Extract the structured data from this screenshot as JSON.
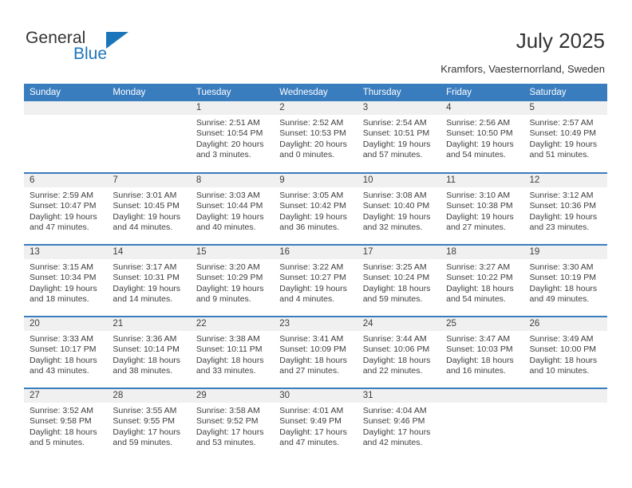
{
  "brand": {
    "name_part1": "General",
    "name_part2": "Blue",
    "triangle_color": "#1b75bb"
  },
  "header": {
    "title": "July 2025",
    "subtitle": "Kramfors, Vaesternorrland, Sweden"
  },
  "theme": {
    "header_blue": "#3a7dbf",
    "datenum_gray": "#f0f0f0",
    "text": "#3d3d3d"
  },
  "calendar": {
    "weekday_headers": [
      "Sunday",
      "Monday",
      "Tuesday",
      "Wednesday",
      "Thursday",
      "Friday",
      "Saturday"
    ],
    "weeks": [
      [
        {
          "empty": true
        },
        {
          "empty": true
        },
        {
          "day": "1",
          "sunrise": "Sunrise: 2:51 AM",
          "sunset": "Sunset: 10:54 PM",
          "daylight1": "Daylight: 20 hours",
          "daylight2": "and 3 minutes."
        },
        {
          "day": "2",
          "sunrise": "Sunrise: 2:52 AM",
          "sunset": "Sunset: 10:53 PM",
          "daylight1": "Daylight: 20 hours",
          "daylight2": "and 0 minutes."
        },
        {
          "day": "3",
          "sunrise": "Sunrise: 2:54 AM",
          "sunset": "Sunset: 10:51 PM",
          "daylight1": "Daylight: 19 hours",
          "daylight2": "and 57 minutes."
        },
        {
          "day": "4",
          "sunrise": "Sunrise: 2:56 AM",
          "sunset": "Sunset: 10:50 PM",
          "daylight1": "Daylight: 19 hours",
          "daylight2": "and 54 minutes."
        },
        {
          "day": "5",
          "sunrise": "Sunrise: 2:57 AM",
          "sunset": "Sunset: 10:49 PM",
          "daylight1": "Daylight: 19 hours",
          "daylight2": "and 51 minutes."
        }
      ],
      [
        {
          "day": "6",
          "sunrise": "Sunrise: 2:59 AM",
          "sunset": "Sunset: 10:47 PM",
          "daylight1": "Daylight: 19 hours",
          "daylight2": "and 47 minutes."
        },
        {
          "day": "7",
          "sunrise": "Sunrise: 3:01 AM",
          "sunset": "Sunset: 10:45 PM",
          "daylight1": "Daylight: 19 hours",
          "daylight2": "and 44 minutes."
        },
        {
          "day": "8",
          "sunrise": "Sunrise: 3:03 AM",
          "sunset": "Sunset: 10:44 PM",
          "daylight1": "Daylight: 19 hours",
          "daylight2": "and 40 minutes."
        },
        {
          "day": "9",
          "sunrise": "Sunrise: 3:05 AM",
          "sunset": "Sunset: 10:42 PM",
          "daylight1": "Daylight: 19 hours",
          "daylight2": "and 36 minutes."
        },
        {
          "day": "10",
          "sunrise": "Sunrise: 3:08 AM",
          "sunset": "Sunset: 10:40 PM",
          "daylight1": "Daylight: 19 hours",
          "daylight2": "and 32 minutes."
        },
        {
          "day": "11",
          "sunrise": "Sunrise: 3:10 AM",
          "sunset": "Sunset: 10:38 PM",
          "daylight1": "Daylight: 19 hours",
          "daylight2": "and 27 minutes."
        },
        {
          "day": "12",
          "sunrise": "Sunrise: 3:12 AM",
          "sunset": "Sunset: 10:36 PM",
          "daylight1": "Daylight: 19 hours",
          "daylight2": "and 23 minutes."
        }
      ],
      [
        {
          "day": "13",
          "sunrise": "Sunrise: 3:15 AM",
          "sunset": "Sunset: 10:34 PM",
          "daylight1": "Daylight: 19 hours",
          "daylight2": "and 18 minutes."
        },
        {
          "day": "14",
          "sunrise": "Sunrise: 3:17 AM",
          "sunset": "Sunset: 10:31 PM",
          "daylight1": "Daylight: 19 hours",
          "daylight2": "and 14 minutes."
        },
        {
          "day": "15",
          "sunrise": "Sunrise: 3:20 AM",
          "sunset": "Sunset: 10:29 PM",
          "daylight1": "Daylight: 19 hours",
          "daylight2": "and 9 minutes."
        },
        {
          "day": "16",
          "sunrise": "Sunrise: 3:22 AM",
          "sunset": "Sunset: 10:27 PM",
          "daylight1": "Daylight: 19 hours",
          "daylight2": "and 4 minutes."
        },
        {
          "day": "17",
          "sunrise": "Sunrise: 3:25 AM",
          "sunset": "Sunset: 10:24 PM",
          "daylight1": "Daylight: 18 hours",
          "daylight2": "and 59 minutes."
        },
        {
          "day": "18",
          "sunrise": "Sunrise: 3:27 AM",
          "sunset": "Sunset: 10:22 PM",
          "daylight1": "Daylight: 18 hours",
          "daylight2": "and 54 minutes."
        },
        {
          "day": "19",
          "sunrise": "Sunrise: 3:30 AM",
          "sunset": "Sunset: 10:19 PM",
          "daylight1": "Daylight: 18 hours",
          "daylight2": "and 49 minutes."
        }
      ],
      [
        {
          "day": "20",
          "sunrise": "Sunrise: 3:33 AM",
          "sunset": "Sunset: 10:17 PM",
          "daylight1": "Daylight: 18 hours",
          "daylight2": "and 43 minutes."
        },
        {
          "day": "21",
          "sunrise": "Sunrise: 3:36 AM",
          "sunset": "Sunset: 10:14 PM",
          "daylight1": "Daylight: 18 hours",
          "daylight2": "and 38 minutes."
        },
        {
          "day": "22",
          "sunrise": "Sunrise: 3:38 AM",
          "sunset": "Sunset: 10:11 PM",
          "daylight1": "Daylight: 18 hours",
          "daylight2": "and 33 minutes."
        },
        {
          "day": "23",
          "sunrise": "Sunrise: 3:41 AM",
          "sunset": "Sunset: 10:09 PM",
          "daylight1": "Daylight: 18 hours",
          "daylight2": "and 27 minutes."
        },
        {
          "day": "24",
          "sunrise": "Sunrise: 3:44 AM",
          "sunset": "Sunset: 10:06 PM",
          "daylight1": "Daylight: 18 hours",
          "daylight2": "and 22 minutes."
        },
        {
          "day": "25",
          "sunrise": "Sunrise: 3:47 AM",
          "sunset": "Sunset: 10:03 PM",
          "daylight1": "Daylight: 18 hours",
          "daylight2": "and 16 minutes."
        },
        {
          "day": "26",
          "sunrise": "Sunrise: 3:49 AM",
          "sunset": "Sunset: 10:00 PM",
          "daylight1": "Daylight: 18 hours",
          "daylight2": "and 10 minutes."
        }
      ],
      [
        {
          "day": "27",
          "sunrise": "Sunrise: 3:52 AM",
          "sunset": "Sunset: 9:58 PM",
          "daylight1": "Daylight: 18 hours",
          "daylight2": "and 5 minutes."
        },
        {
          "day": "28",
          "sunrise": "Sunrise: 3:55 AM",
          "sunset": "Sunset: 9:55 PM",
          "daylight1": "Daylight: 17 hours",
          "daylight2": "and 59 minutes."
        },
        {
          "day": "29",
          "sunrise": "Sunrise: 3:58 AM",
          "sunset": "Sunset: 9:52 PM",
          "daylight1": "Daylight: 17 hours",
          "daylight2": "and 53 minutes."
        },
        {
          "day": "30",
          "sunrise": "Sunrise: 4:01 AM",
          "sunset": "Sunset: 9:49 PM",
          "daylight1": "Daylight: 17 hours",
          "daylight2": "and 47 minutes."
        },
        {
          "day": "31",
          "sunrise": "Sunrise: 4:04 AM",
          "sunset": "Sunset: 9:46 PM",
          "daylight1": "Daylight: 17 hours",
          "daylight2": "and 42 minutes."
        },
        {
          "empty": true
        },
        {
          "empty": true
        }
      ]
    ]
  }
}
